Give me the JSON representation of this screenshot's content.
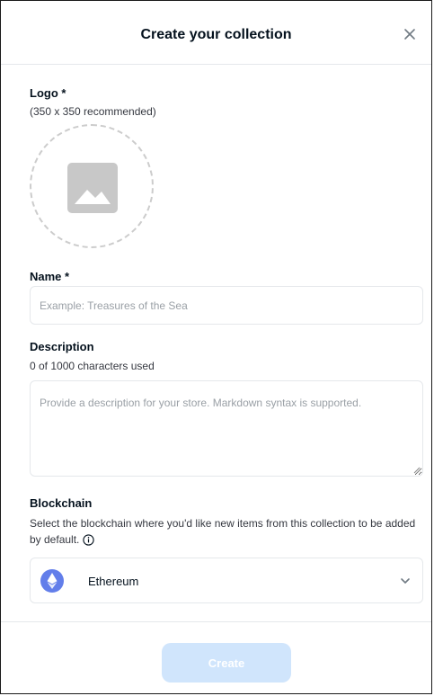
{
  "header": {
    "title": "Create your collection"
  },
  "logo": {
    "label": "Logo *",
    "hint": "(350 x 350 recommended)"
  },
  "name": {
    "label": "Name *",
    "placeholder": "Example: Treasures of the Sea",
    "value": ""
  },
  "description": {
    "label": "Description",
    "counter": "0 of 1000 characters used",
    "placeholder": "Provide a description for your store. Markdown syntax is supported.",
    "value": ""
  },
  "blockchain": {
    "label": "Blockchain",
    "description": "Select the blockchain where you'd like new items from this collection to be added by default.",
    "selected": "Ethereum"
  },
  "footer": {
    "create_label": "Create"
  },
  "colors": {
    "text": "#04111d",
    "border": "#e5e8eb",
    "create_disabled_bg": "#d0e5fc",
    "eth_icon_bg": "#627eea",
    "placeholder_icon": "#c8c8c8"
  }
}
